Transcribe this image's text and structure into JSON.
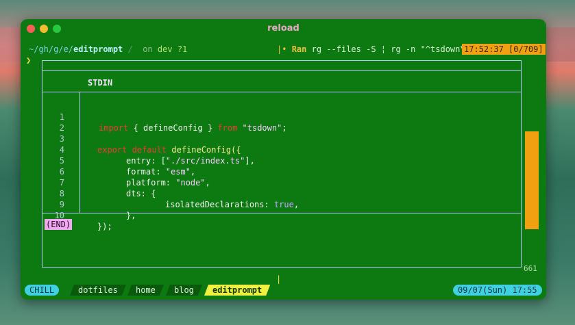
{
  "window": {
    "title": "reload"
  },
  "prompt": {
    "path_prefix": "~/gh/g/e/",
    "path_dir": "editprompt",
    "separator": "/",
    "on": "on",
    "branch": "dev",
    "dirty": "?1",
    "chevron": "❯"
  },
  "status": {
    "bar": "|",
    "bullet": "•",
    "ran_label": "Ran",
    "command": "rg --files -S ¦ rg -n \"^tsdown\\.",
    "clock": "17:52:37 [0/709]"
  },
  "pager": {
    "label": "STDIN",
    "end_label": "(END)",
    "scroll_count": "661",
    "lines": [
      {
        "n": "1",
        "t1": "  ",
        "kw": "import",
        "rest": " { defineConfig } ",
        "kw2": "from",
        "str": " \"tsdown\"",
        "tail": ";"
      },
      {
        "n": "2",
        "text": ""
      },
      {
        "n": "3",
        "text": ""
      },
      {
        "n": "4",
        "text": ""
      },
      {
        "n": "5",
        "text": ""
      },
      {
        "n": "6",
        "text": ""
      },
      {
        "n": "7",
        "text": ""
      },
      {
        "n": "8",
        "text": ""
      },
      {
        "n": "9",
        "text": ""
      },
      {
        "n": "10",
        "text": ""
      }
    ],
    "l3_export": "export default",
    "l3_fn": "defineConfig",
    "l3_tail": "({",
    "l4_key": "entry: [",
    "l4_str": "\"./src/index.ts\"",
    "l4_tail": "],",
    "l5_key": "format: ",
    "l5_str": "\"esm\"",
    "l5_tail": ",",
    "l6_key": "platform: ",
    "l6_str": "\"node\"",
    "l6_tail": ",",
    "l7_text": "dts: {",
    "l8_key": "isolatedDeclarations: ",
    "l8_bool": "true",
    "l8_tail": ",",
    "l9_text": "},",
    "l10_text": "});"
  },
  "tmux": {
    "session": "CHILL",
    "windows": [
      "dotfiles",
      "home",
      "blog",
      "editprompt"
    ],
    "active_window": "editprompt",
    "datetime": "09/07(Sun) 17:55"
  },
  "colors": {
    "terminal_bg": "#0c7a10",
    "accent_orange": "#f0a010",
    "accent_cyan": "#40d0e0",
    "accent_yellow": "#f0f040",
    "keyword_red": "#e83a3a"
  }
}
